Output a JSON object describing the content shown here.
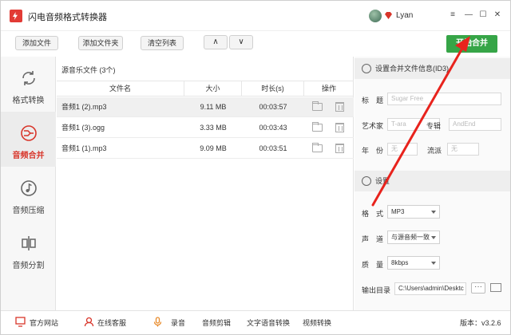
{
  "app": {
    "title": "闪电音频格式转换器",
    "user_name": "Lyan"
  },
  "window_controls": {
    "menu": "≡",
    "minimize": "—",
    "maximize": "☐",
    "close": "✕"
  },
  "toolbar": {
    "add_file": "添加文件",
    "add_folder": "添加文件夹",
    "clear_list": "清空列表",
    "move_up": "∧",
    "move_down": "∨",
    "start_merge": "开始合并"
  },
  "sidebar": {
    "items": [
      {
        "label": "格式转换",
        "icon": "refresh-icon",
        "active": false
      },
      {
        "label": "音频合并",
        "icon": "merge-icon",
        "active": true
      },
      {
        "label": "音频压缩",
        "icon": "compress-icon",
        "active": false
      },
      {
        "label": "音频分割",
        "icon": "split-icon",
        "active": false
      }
    ]
  },
  "file_list": {
    "header": "源音乐文件 (3个)",
    "columns": {
      "name": "文件名",
      "size": "大小",
      "duration": "时长(s)",
      "actions": "操作"
    },
    "rows": [
      {
        "name": "音频1 (2).mp3",
        "size": "9.11 MB",
        "duration": "00:03:57"
      },
      {
        "name": "音频1 (3).ogg",
        "size": "3.33 MB",
        "duration": "00:03:43"
      },
      {
        "name": "音频1 (1).mp3",
        "size": "9.09 MB",
        "duration": "00:03:51"
      }
    ]
  },
  "id3": {
    "section_title": "设置合并文件信息(ID3)",
    "title_label": "标　题",
    "title_placeholder": "Sugar Free",
    "artist_label": "艺术家",
    "artist_placeholder": "T-ara",
    "album_label": "专辑",
    "album_placeholder": "AndEnd",
    "year_label": "年　份",
    "year_placeholder": "无",
    "genre_label": "流派",
    "genre_placeholder": "无"
  },
  "settings": {
    "section_title": "设置",
    "format_label": "格　式",
    "format_value": "MP3",
    "channel_label": "声　道",
    "channel_value": "与源音频一致",
    "quality_label": "质　量",
    "quality_value": "8kbps",
    "output_label": "输出目录",
    "output_value": "C:\\Users\\admin\\Desktc",
    "browse_dots": "···"
  },
  "bottom_bar": {
    "website": "官方网站",
    "service": "在线客服",
    "record": "录音",
    "audio_edit": "音频剪辑",
    "tts": "文字语音转换",
    "video_convert": "视频转换",
    "version": "版本：v3.2.6"
  },
  "colors": {
    "accent_red": "#d8352a",
    "start_green": "#36a547",
    "annotation": "#e8231d"
  }
}
